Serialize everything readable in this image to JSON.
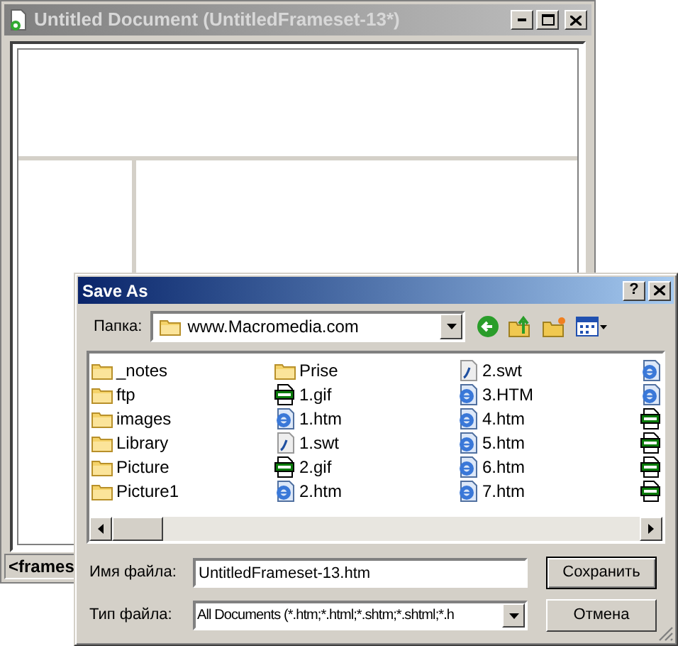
{
  "document_window": {
    "title": "Untitled Document (UntitledFrameset-13*)",
    "status_tag": "<frames"
  },
  "dialog": {
    "title": "Save As",
    "help": "?",
    "folder_label": "Папка:",
    "folder": "www.Macromedia.com",
    "files": [
      {
        "kind": "folder",
        "name": "_notes"
      },
      {
        "kind": "folder",
        "name": "ftp"
      },
      {
        "kind": "folder",
        "name": "images"
      },
      {
        "kind": "folder",
        "name": "Library"
      },
      {
        "kind": "folder",
        "name": "Picture"
      },
      {
        "kind": "folder",
        "name": "Picture1"
      },
      {
        "kind": "folder",
        "name": "Prise"
      },
      {
        "kind": "gif",
        "name": "1.gif"
      },
      {
        "kind": "htm",
        "name": "1.htm"
      },
      {
        "kind": "swt",
        "name": "1.swt"
      },
      {
        "kind": "gif",
        "name": "2.gif"
      },
      {
        "kind": "htm",
        "name": "2.htm"
      },
      {
        "kind": "swt",
        "name": "2.swt"
      },
      {
        "kind": "htm",
        "name": "3.HTM"
      },
      {
        "kind": "htm",
        "name": "4.htm"
      },
      {
        "kind": "htm",
        "name": "5.htm"
      },
      {
        "kind": "htm",
        "name": "6.htm"
      },
      {
        "kind": "htm",
        "name": "7.htm"
      },
      {
        "kind": "htm"
      },
      {
        "kind": "htm"
      },
      {
        "kind": "gif"
      },
      {
        "kind": "gif"
      },
      {
        "kind": "gif"
      },
      {
        "kind": "gif"
      }
    ],
    "filename_label": "Имя файла:",
    "filename": "UntitledFrameset-13.htm",
    "filetype_label": "Тип файла:",
    "filetype": "All Documents (*.htm;*.html;*.shtm;*.shtml;*.h",
    "buttons": [
      "Сохранить",
      "Отмена"
    ]
  }
}
